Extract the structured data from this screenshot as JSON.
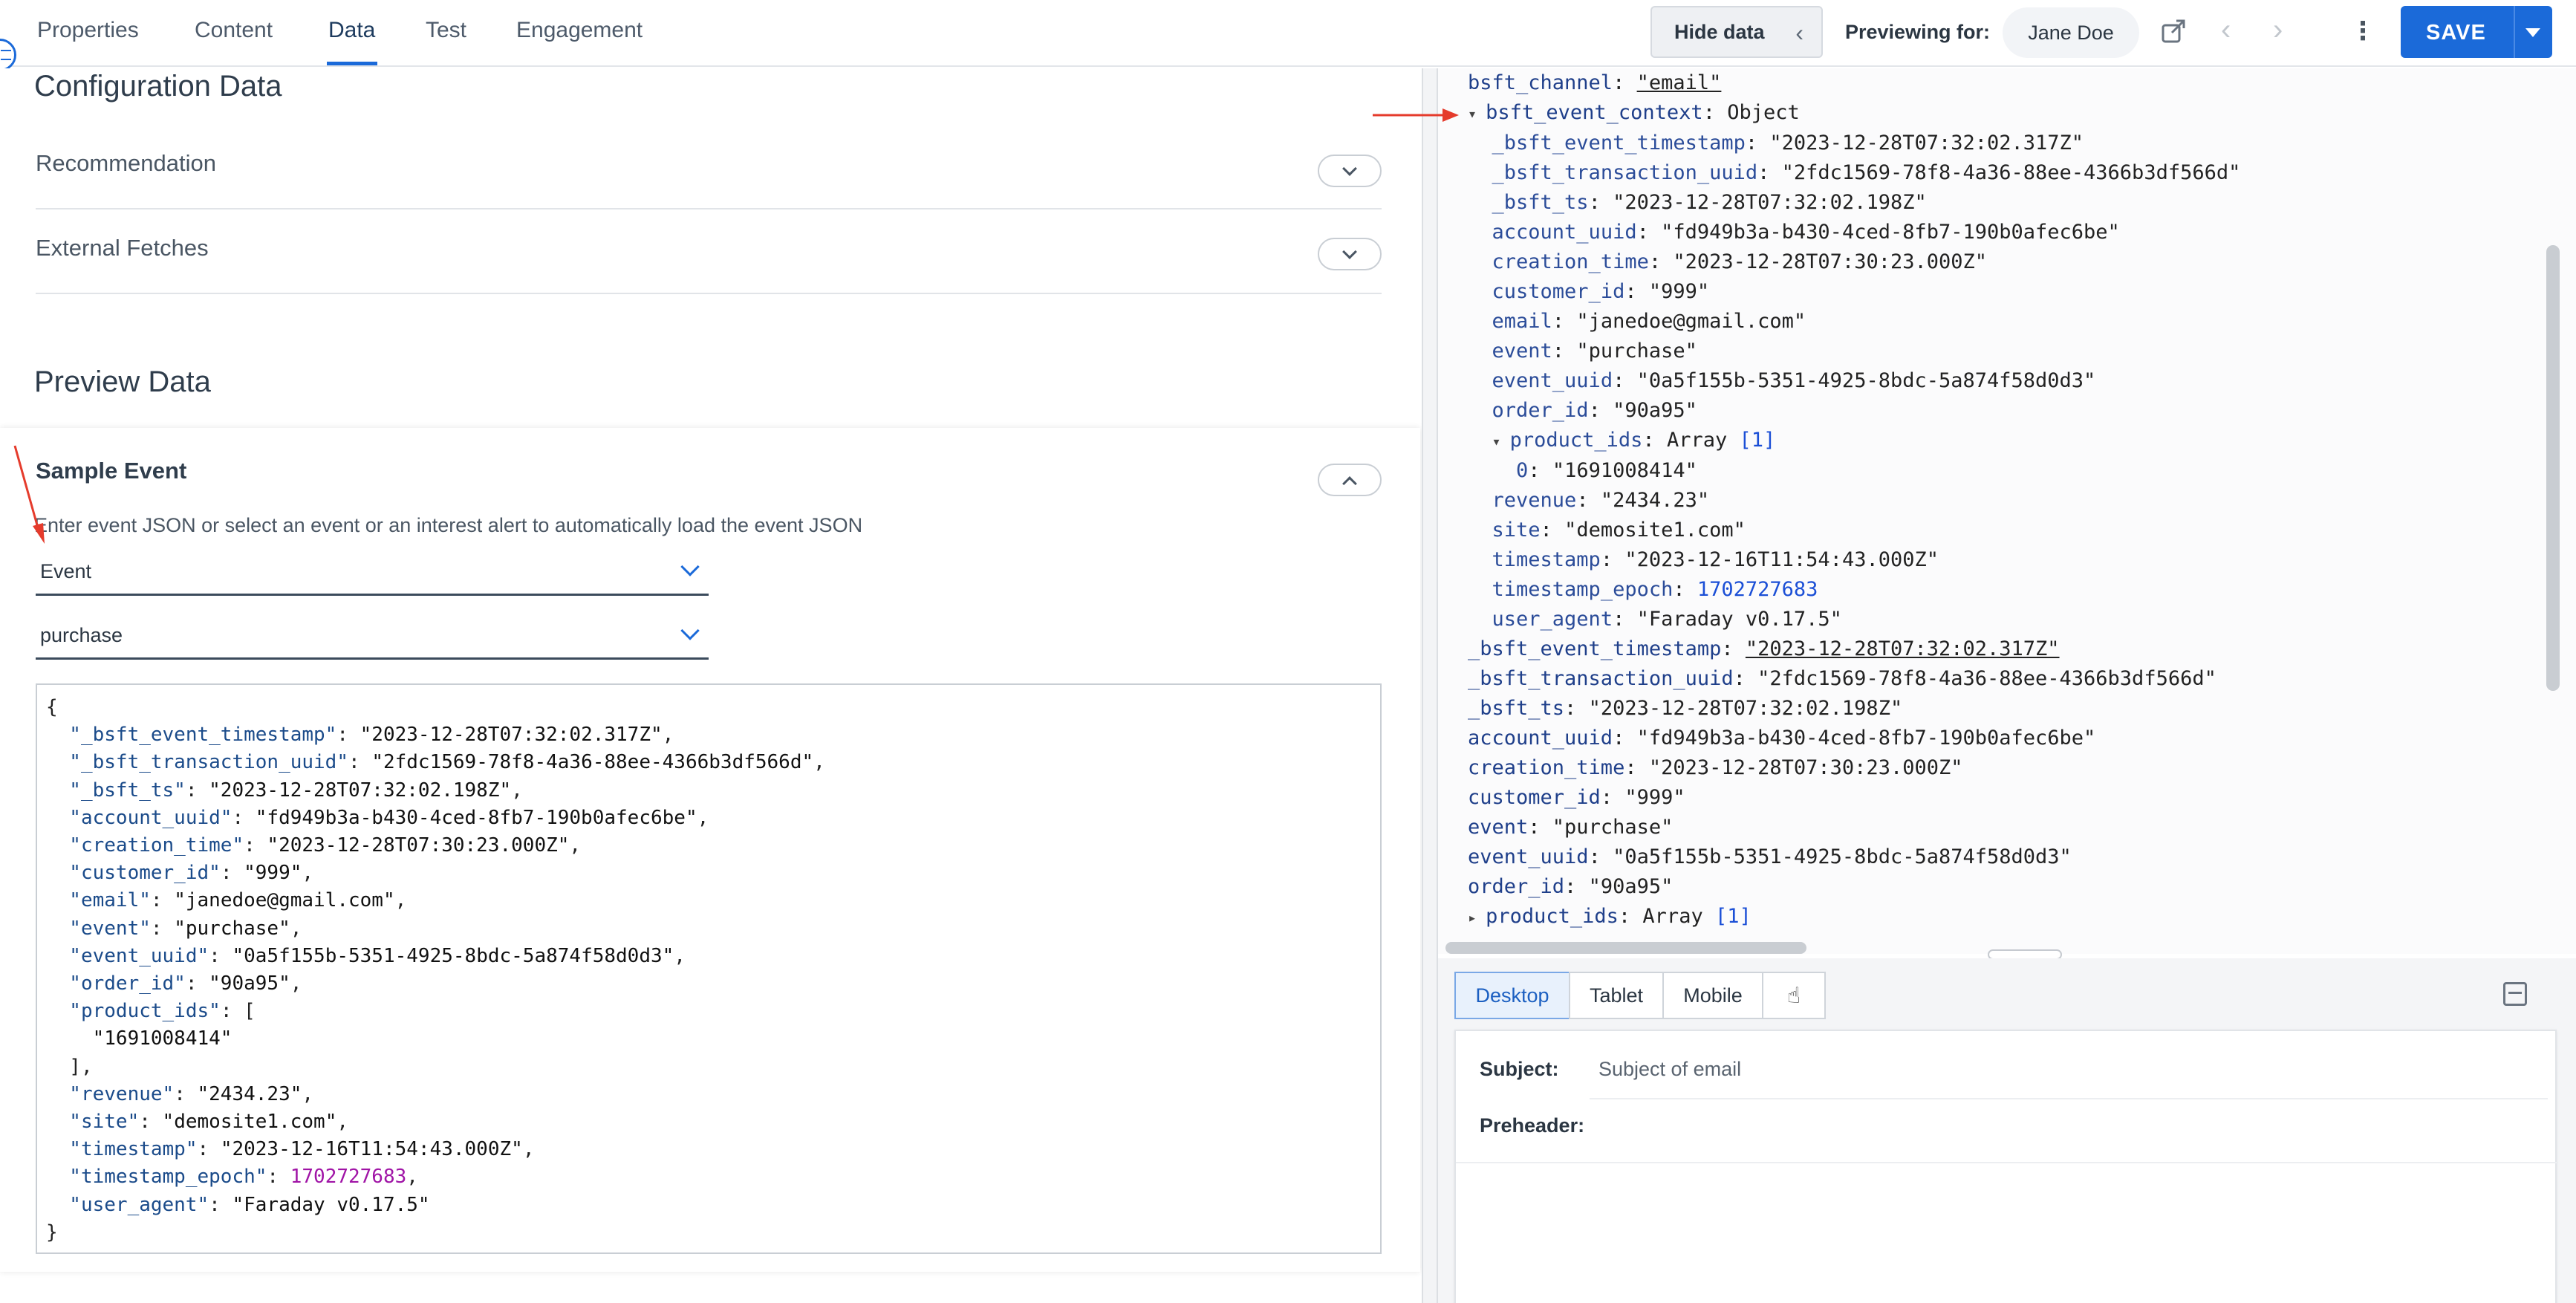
{
  "tabs": [
    "Properties",
    "Content",
    "Data",
    "Test",
    "Engagement"
  ],
  "active_tab": "Data",
  "toolbar": {
    "hide_data_label": "Hide data",
    "previewing_label": "Previewing for:",
    "user_name": "Jane Doe",
    "save_label": "SAVE",
    "icons": [
      "external-link-icon",
      "chevron-left-icon",
      "chevron-right-icon",
      "kebab-menu-icon",
      "caret-down-icon"
    ]
  },
  "config": {
    "title": "Configuration Data",
    "sections": [
      "Recommendation",
      "External Fetches"
    ]
  },
  "preview_data": {
    "title": "Preview Data",
    "sample_event": {
      "title": "Sample Event",
      "help_text": "Enter event JSON or select an event or an interest alert to automatically load the event JSON",
      "source_select": "Event",
      "event_select": "purchase",
      "json_lines": [
        [
          [
            "p",
            "{"
          ]
        ],
        [
          [
            "k",
            "  \"_bsft_event_timestamp\""
          ],
          [
            "p",
            ": "
          ],
          [
            "s",
            "\"2023-12-28T07:32:02.317Z\""
          ],
          [
            "p",
            ","
          ]
        ],
        [
          [
            "k",
            "  \"_bsft_transaction_uuid\""
          ],
          [
            "p",
            ": "
          ],
          [
            "s",
            "\"2fdc1569-78f8-4a36-88ee-4366b3df566d\""
          ],
          [
            "p",
            ","
          ]
        ],
        [
          [
            "k",
            "  \"_bsft_ts\""
          ],
          [
            "p",
            ": "
          ],
          [
            "s",
            "\"2023-12-28T07:32:02.198Z\""
          ],
          [
            "p",
            ","
          ]
        ],
        [
          [
            "k",
            "  \"account_uuid\""
          ],
          [
            "p",
            ": "
          ],
          [
            "s",
            "\"fd949b3a-b430-4ced-8fb7-190b0afec6be\""
          ],
          [
            "p",
            ","
          ]
        ],
        [
          [
            "k",
            "  \"creation_time\""
          ],
          [
            "p",
            ": "
          ],
          [
            "s",
            "\"2023-12-28T07:30:23.000Z\""
          ],
          [
            "p",
            ","
          ]
        ],
        [
          [
            "k",
            "  \"customer_id\""
          ],
          [
            "p",
            ": "
          ],
          [
            "s",
            "\"999\""
          ],
          [
            "p",
            ","
          ]
        ],
        [
          [
            "k",
            "  \"email\""
          ],
          [
            "p",
            ": "
          ],
          [
            "s",
            "\"janedoe@gmail.com\""
          ],
          [
            "p",
            ","
          ]
        ],
        [
          [
            "k",
            "  \"event\""
          ],
          [
            "p",
            ": "
          ],
          [
            "s",
            "\"purchase\""
          ],
          [
            "p",
            ","
          ]
        ],
        [
          [
            "k",
            "  \"event_uuid\""
          ],
          [
            "p",
            ": "
          ],
          [
            "s",
            "\"0a5f155b-5351-4925-8bdc-5a874f58d0d3\""
          ],
          [
            "p",
            ","
          ]
        ],
        [
          [
            "k",
            "  \"order_id\""
          ],
          [
            "p",
            ": "
          ],
          [
            "s",
            "\"90a95\""
          ],
          [
            "p",
            ","
          ]
        ],
        [
          [
            "k",
            "  \"product_ids\""
          ],
          [
            "p",
            ": ["
          ]
        ],
        [
          [
            "s",
            "    \"1691008414\""
          ]
        ],
        [
          [
            "p",
            "  ],"
          ]
        ],
        [
          [
            "k",
            "  \"revenue\""
          ],
          [
            "p",
            ": "
          ],
          [
            "s",
            "\"2434.23\""
          ],
          [
            "p",
            ","
          ]
        ],
        [
          [
            "k",
            "  \"site\""
          ],
          [
            "p",
            ": "
          ],
          [
            "s",
            "\"demosite1.com\""
          ],
          [
            "p",
            ","
          ]
        ],
        [
          [
            "k",
            "  \"timestamp\""
          ],
          [
            "p",
            ": "
          ],
          [
            "s",
            "\"2023-12-16T11:54:43.000Z\""
          ],
          [
            "p",
            ","
          ]
        ],
        [
          [
            "k",
            "  \"timestamp_epoch\""
          ],
          [
            "p",
            ": "
          ],
          [
            "n",
            "1702727683"
          ],
          [
            "p",
            ","
          ]
        ],
        [
          [
            "k",
            "  \"user_agent\""
          ],
          [
            "p",
            ": "
          ],
          [
            "s",
            "\"Faraday v0.17.5\""
          ]
        ],
        [
          [
            "p",
            "}"
          ]
        ]
      ]
    }
  },
  "inspector_lines": [
    [
      [
        "ik",
        "bsft_channel"
      ],
      [
        "p",
        ": "
      ],
      [
        "ivu",
        "\"email\""
      ]
    ],
    [
      [
        "tri",
        "▾ "
      ],
      [
        "ik",
        "bsft_event_context"
      ],
      [
        "p",
        ": "
      ],
      [
        "iv",
        "Object"
      ]
    ],
    [
      [
        "sp",
        "  "
      ],
      [
        "ik2",
        "_bsft_event_timestamp"
      ],
      [
        "p",
        ": "
      ],
      [
        "iv",
        "\"2023-12-28T07:32:02.317Z\""
      ]
    ],
    [
      [
        "sp",
        "  "
      ],
      [
        "ik2",
        "_bsft_transaction_uuid"
      ],
      [
        "p",
        ": "
      ],
      [
        "iv",
        "\"2fdc1569-78f8-4a36-88ee-4366b3df566d\""
      ]
    ],
    [
      [
        "sp",
        "  "
      ],
      [
        "ik2",
        "_bsft_ts"
      ],
      [
        "p",
        ": "
      ],
      [
        "iv",
        "\"2023-12-28T07:32:02.198Z\""
      ]
    ],
    [
      [
        "sp",
        "  "
      ],
      [
        "ik2",
        "account_uuid"
      ],
      [
        "p",
        ": "
      ],
      [
        "iv",
        "\"fd949b3a-b430-4ced-8fb7-190b0afec6be\""
      ]
    ],
    [
      [
        "sp",
        "  "
      ],
      [
        "ik2",
        "creation_time"
      ],
      [
        "p",
        ": "
      ],
      [
        "iv",
        "\"2023-12-28T07:30:23.000Z\""
      ]
    ],
    [
      [
        "sp",
        "  "
      ],
      [
        "ik2",
        "customer_id"
      ],
      [
        "p",
        ": "
      ],
      [
        "iv",
        "\"999\""
      ]
    ],
    [
      [
        "sp",
        "  "
      ],
      [
        "ik2",
        "email"
      ],
      [
        "p",
        ": "
      ],
      [
        "iv",
        "\"janedoe@gmail.com\""
      ]
    ],
    [
      [
        "sp",
        "  "
      ],
      [
        "ik2",
        "event"
      ],
      [
        "p",
        ": "
      ],
      [
        "iv",
        "\"purchase\""
      ]
    ],
    [
      [
        "sp",
        "  "
      ],
      [
        "ik2",
        "event_uuid"
      ],
      [
        "p",
        ": "
      ],
      [
        "iv",
        "\"0a5f155b-5351-4925-8bdc-5a874f58d0d3\""
      ]
    ],
    [
      [
        "sp",
        "  "
      ],
      [
        "ik2",
        "order_id"
      ],
      [
        "p",
        ": "
      ],
      [
        "iv",
        "\"90a95\""
      ]
    ],
    [
      [
        "sp",
        "  "
      ],
      [
        "tri",
        "▾ "
      ],
      [
        "ik2",
        "product_ids"
      ],
      [
        "p",
        ": "
      ],
      [
        "iv",
        "Array "
      ],
      [
        "inum",
        "[1]"
      ]
    ],
    [
      [
        "sp",
        "    "
      ],
      [
        "ik2",
        "0"
      ],
      [
        "p",
        ": "
      ],
      [
        "iv",
        "\"1691008414\""
      ]
    ],
    [
      [
        "sp",
        "  "
      ],
      [
        "ik2",
        "revenue"
      ],
      [
        "p",
        ": "
      ],
      [
        "iv",
        "\"2434.23\""
      ]
    ],
    [
      [
        "sp",
        "  "
      ],
      [
        "ik2",
        "site"
      ],
      [
        "p",
        ": "
      ],
      [
        "iv",
        "\"demosite1.com\""
      ]
    ],
    [
      [
        "sp",
        "  "
      ],
      [
        "ik2",
        "timestamp"
      ],
      [
        "p",
        ": "
      ],
      [
        "iv",
        "\"2023-12-16T11:54:43.000Z\""
      ]
    ],
    [
      [
        "sp",
        "  "
      ],
      [
        "ik2",
        "timestamp_epoch"
      ],
      [
        "p",
        ": "
      ],
      [
        "inum",
        "1702727683"
      ]
    ],
    [
      [
        "sp",
        "  "
      ],
      [
        "ik2",
        "user_agent"
      ],
      [
        "p",
        ": "
      ],
      [
        "iv",
        "\"Faraday v0.17.5\""
      ]
    ],
    [
      [
        "ik",
        "_bsft_event_timestamp"
      ],
      [
        "p",
        ": "
      ],
      [
        "ivu",
        "\"2023-12-28T07:32:02.317Z\""
      ]
    ],
    [
      [
        "ik",
        "_bsft_transaction_uuid"
      ],
      [
        "p",
        ": "
      ],
      [
        "iv",
        "\"2fdc1569-78f8-4a36-88ee-4366b3df566d\""
      ]
    ],
    [
      [
        "ik",
        "_bsft_ts"
      ],
      [
        "p",
        ": "
      ],
      [
        "iv",
        "\"2023-12-28T07:32:02.198Z\""
      ]
    ],
    [
      [
        "ik",
        "account_uuid"
      ],
      [
        "p",
        ": "
      ],
      [
        "iv",
        "\"fd949b3a-b430-4ced-8fb7-190b0afec6be\""
      ]
    ],
    [
      [
        "ik",
        "creation_time"
      ],
      [
        "p",
        ": "
      ],
      [
        "iv",
        "\"2023-12-28T07:30:23.000Z\""
      ]
    ],
    [
      [
        "ik",
        "customer_id"
      ],
      [
        "p",
        ": "
      ],
      [
        "iv",
        "\"999\""
      ]
    ],
    [
      [
        "ik",
        "event"
      ],
      [
        "p",
        ": "
      ],
      [
        "iv",
        "\"purchase\""
      ]
    ],
    [
      [
        "ik",
        "event_uuid"
      ],
      [
        "p",
        ": "
      ],
      [
        "iv",
        "\"0a5f155b-5351-4925-8bdc-5a874f58d0d3\""
      ]
    ],
    [
      [
        "ik",
        "order_id"
      ],
      [
        "p",
        ": "
      ],
      [
        "iv",
        "\"90a95\""
      ]
    ],
    [
      [
        "tri",
        "▸ "
      ],
      [
        "ik",
        "product_ids"
      ],
      [
        "p",
        ": "
      ],
      [
        "iv",
        "Array "
      ],
      [
        "inum",
        "[1]"
      ]
    ]
  ],
  "preview": {
    "device_tabs": [
      "Desktop",
      "Tablet",
      "Mobile"
    ],
    "active_device": "Desktop",
    "subject_label": "Subject:",
    "subject_value": "Subject of email",
    "preheader_label": "Preheader:"
  },
  "colors": {
    "accent": "#1b6ad9",
    "annotation_arrow": "#e53b2c",
    "json_key": "#1b4b8a",
    "json_number": "#a014a6"
  }
}
